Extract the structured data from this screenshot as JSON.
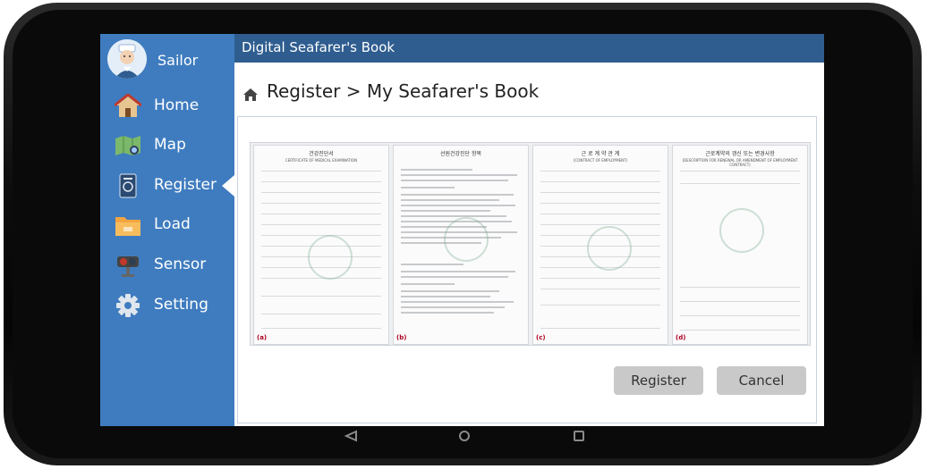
{
  "app": {
    "title": "Digital Seafarer's Book"
  },
  "user": {
    "name": "Sailor"
  },
  "sidebar": {
    "items": [
      {
        "label": "Home",
        "icon": "home-icon"
      },
      {
        "label": "Map",
        "icon": "map-icon"
      },
      {
        "label": "Register",
        "icon": "register-icon",
        "active": true
      },
      {
        "label": "Load",
        "icon": "folder-icon"
      },
      {
        "label": "Sensor",
        "icon": "sensor-icon"
      },
      {
        "label": "Setting",
        "icon": "gear-icon"
      }
    ]
  },
  "breadcrumb": {
    "text": "Register > My Seafarer's Book"
  },
  "documents": [
    {
      "letter": "(a)",
      "title": "건강진단서",
      "subtitle": "CERTIFICATE OF MEDICAL EXAMINATION"
    },
    {
      "letter": "(b)",
      "title": "선원건강진단 항목",
      "subtitle": ""
    },
    {
      "letter": "(c)",
      "title": "근 로 계 약 관 계",
      "subtitle": "(CONTRACT OF EMPLOYMENT)"
    },
    {
      "letter": "(d)",
      "title": "근로계약의 갱신 또는 변경사항",
      "subtitle": "(DESCRIPTION FOR RENEWAL OR AMENDMENT OF EMPLOYMENT CONTRACT)"
    }
  ],
  "buttons": {
    "register": "Register",
    "cancel": "Cancel"
  },
  "colors": {
    "sidebar": "#3f7cbf",
    "topbar": "#2f5d8f",
    "button": "#c9c9c9"
  }
}
